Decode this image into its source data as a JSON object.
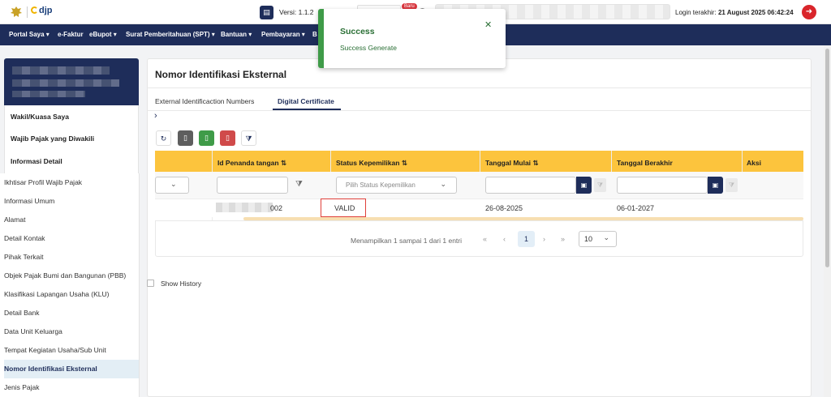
{
  "header": {
    "logo_text": "djp",
    "versi_label": "Versi: 1.1.2",
    "baru_badge": "Baru",
    "login_label": "Login terakhir:",
    "login_time": "21 August 2025 06:42:24"
  },
  "nav": {
    "items": [
      "Portal Saya ▾",
      "e-Faktur",
      "eBupot ▾",
      "Surat Pemberitahuan (SPT) ▾",
      "Bantuan ▾",
      "Pembayaran ▾",
      "B"
    ]
  },
  "sidebar": {
    "headings": [
      "Wakil/Kuasa Saya",
      "Wajib Pajak yang Diwakili",
      "Informasi Detail"
    ],
    "items": [
      "Ikhtisar Profil Wajib Pajak",
      "Informasi Umum",
      "Alamat",
      "Detail Kontak",
      "Pihak Terkait",
      "Objek Pajak Bumi dan Bangunan (PBB)",
      "Klasifikasi Lapangan Usaha (KLU)",
      "Detail Bank",
      "Data Unit Keluarga",
      "Tempat Kegiatan Usaha/Sub Unit",
      "Nomor Identifikasi Eksternal",
      "Jenis Pajak"
    ],
    "active_index": 10
  },
  "main": {
    "title": "Nomor Identifikasi Eksternal",
    "tabs": [
      "External Identificaction Numbers",
      "Digital Certificate"
    ],
    "active_tab": 1,
    "columns": [
      "Id Penanda tangan ⇅",
      "Status Kepemilikan ⇅",
      "Tanggal Mulai ⇅",
      "Tanggal Berakhir",
      "Aksi"
    ],
    "filter_placeholder": "Pilih Status Kepemilikan",
    "row": {
      "id_suffix": "002",
      "status": "VALID",
      "tanggal_mulai": "26-08-2025",
      "tanggal_berakhir": "06-01-2027"
    },
    "pager": {
      "summary": "Menampilkan 1 sampai 1 dari 1 entri",
      "current_page": "1",
      "page_size": "10"
    },
    "show_history_label": "Show History"
  },
  "toast": {
    "title": "Success",
    "message": "Success Generate"
  },
  "colors": {
    "navy": "#1e2d5a",
    "header_yellow": "#fcc43d",
    "success_green": "#3f9b48",
    "logout_red": "#d9252b"
  }
}
